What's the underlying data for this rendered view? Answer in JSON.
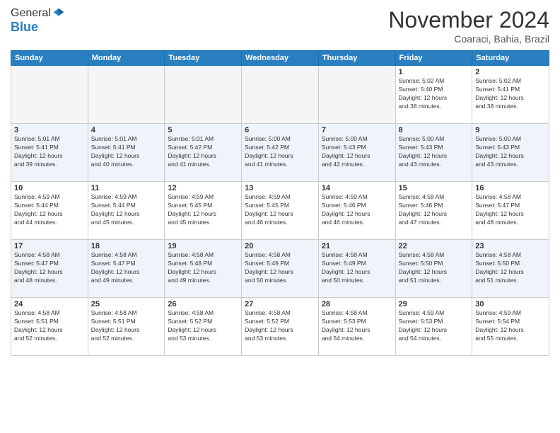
{
  "header": {
    "logo_line1": "General",
    "logo_line2": "Blue",
    "month": "November 2024",
    "location": "Coaraci, Bahia, Brazil"
  },
  "weekdays": [
    "Sunday",
    "Monday",
    "Tuesday",
    "Wednesday",
    "Thursday",
    "Friday",
    "Saturday"
  ],
  "weeks": [
    [
      {
        "day": "",
        "info": ""
      },
      {
        "day": "",
        "info": ""
      },
      {
        "day": "",
        "info": ""
      },
      {
        "day": "",
        "info": ""
      },
      {
        "day": "",
        "info": ""
      },
      {
        "day": "1",
        "info": "Sunrise: 5:02 AM\nSunset: 5:40 PM\nDaylight: 12 hours\nand 38 minutes."
      },
      {
        "day": "2",
        "info": "Sunrise: 5:02 AM\nSunset: 5:41 PM\nDaylight: 12 hours\nand 38 minutes."
      }
    ],
    [
      {
        "day": "3",
        "info": "Sunrise: 5:01 AM\nSunset: 5:41 PM\nDaylight: 12 hours\nand 39 minutes."
      },
      {
        "day": "4",
        "info": "Sunrise: 5:01 AM\nSunset: 5:41 PM\nDaylight: 12 hours\nand 40 minutes."
      },
      {
        "day": "5",
        "info": "Sunrise: 5:01 AM\nSunset: 5:42 PM\nDaylight: 12 hours\nand 41 minutes."
      },
      {
        "day": "6",
        "info": "Sunrise: 5:00 AM\nSunset: 5:42 PM\nDaylight: 12 hours\nand 41 minutes."
      },
      {
        "day": "7",
        "info": "Sunrise: 5:00 AM\nSunset: 5:43 PM\nDaylight: 12 hours\nand 42 minutes."
      },
      {
        "day": "8",
        "info": "Sunrise: 5:00 AM\nSunset: 5:43 PM\nDaylight: 12 hours\nand 43 minutes."
      },
      {
        "day": "9",
        "info": "Sunrise: 5:00 AM\nSunset: 5:43 PM\nDaylight: 12 hours\nand 43 minutes."
      }
    ],
    [
      {
        "day": "10",
        "info": "Sunrise: 4:59 AM\nSunset: 5:44 PM\nDaylight: 12 hours\nand 44 minutes."
      },
      {
        "day": "11",
        "info": "Sunrise: 4:59 AM\nSunset: 5:44 PM\nDaylight: 12 hours\nand 45 minutes."
      },
      {
        "day": "12",
        "info": "Sunrise: 4:59 AM\nSunset: 5:45 PM\nDaylight: 12 hours\nand 45 minutes."
      },
      {
        "day": "13",
        "info": "Sunrise: 4:59 AM\nSunset: 5:45 PM\nDaylight: 12 hours\nand 46 minutes."
      },
      {
        "day": "14",
        "info": "Sunrise: 4:59 AM\nSunset: 5:46 PM\nDaylight: 12 hours\nand 46 minutes."
      },
      {
        "day": "15",
        "info": "Sunrise: 4:58 AM\nSunset: 5:46 PM\nDaylight: 12 hours\nand 47 minutes."
      },
      {
        "day": "16",
        "info": "Sunrise: 4:58 AM\nSunset: 5:47 PM\nDaylight: 12 hours\nand 48 minutes."
      }
    ],
    [
      {
        "day": "17",
        "info": "Sunrise: 4:58 AM\nSunset: 5:47 PM\nDaylight: 12 hours\nand 48 minutes."
      },
      {
        "day": "18",
        "info": "Sunrise: 4:58 AM\nSunset: 5:47 PM\nDaylight: 12 hours\nand 49 minutes."
      },
      {
        "day": "19",
        "info": "Sunrise: 4:58 AM\nSunset: 5:48 PM\nDaylight: 12 hours\nand 49 minutes."
      },
      {
        "day": "20",
        "info": "Sunrise: 4:58 AM\nSunset: 5:49 PM\nDaylight: 12 hours\nand 50 minutes."
      },
      {
        "day": "21",
        "info": "Sunrise: 4:58 AM\nSunset: 5:49 PM\nDaylight: 12 hours\nand 50 minutes."
      },
      {
        "day": "22",
        "info": "Sunrise: 4:58 AM\nSunset: 5:50 PM\nDaylight: 12 hours\nand 51 minutes."
      },
      {
        "day": "23",
        "info": "Sunrise: 4:58 AM\nSunset: 5:50 PM\nDaylight: 12 hours\nand 51 minutes."
      }
    ],
    [
      {
        "day": "24",
        "info": "Sunrise: 4:58 AM\nSunset: 5:51 PM\nDaylight: 12 hours\nand 52 minutes."
      },
      {
        "day": "25",
        "info": "Sunrise: 4:58 AM\nSunset: 5:51 PM\nDaylight: 12 hours\nand 52 minutes."
      },
      {
        "day": "26",
        "info": "Sunrise: 4:58 AM\nSunset: 5:52 PM\nDaylight: 12 hours\nand 53 minutes."
      },
      {
        "day": "27",
        "info": "Sunrise: 4:58 AM\nSunset: 5:52 PM\nDaylight: 12 hours\nand 53 minutes."
      },
      {
        "day": "28",
        "info": "Sunrise: 4:58 AM\nSunset: 5:53 PM\nDaylight: 12 hours\nand 54 minutes."
      },
      {
        "day": "29",
        "info": "Sunrise: 4:59 AM\nSunset: 5:53 PM\nDaylight: 12 hours\nand 54 minutes."
      },
      {
        "day": "30",
        "info": "Sunrise: 4:59 AM\nSunset: 5:54 PM\nDaylight: 12 hours\nand 55 minutes."
      }
    ]
  ]
}
